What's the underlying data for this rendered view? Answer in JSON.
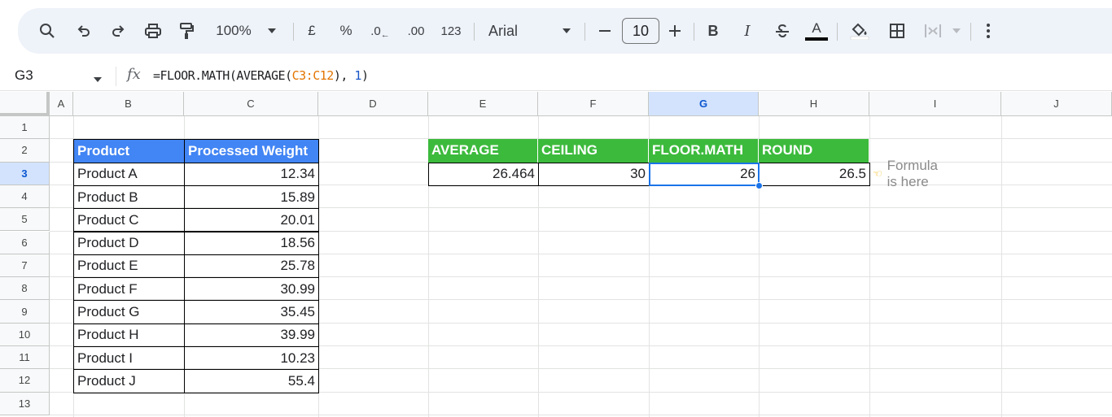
{
  "toolbar": {
    "zoom": "100%",
    "currency": "£",
    "percent": "%",
    "dec_decrease": ".0",
    "dec_increase": ".00",
    "number_format": "123",
    "font_name": "Arial",
    "font_size": "10",
    "bold": "B",
    "italic": "I",
    "text_color": "A"
  },
  "formula_bar": {
    "name_box": "G3",
    "fx": "fx",
    "formula_prefix": "=FLOOR.MATH(AVERAGE(",
    "formula_ref": "C3:C12",
    "formula_mid": "), ",
    "formula_num": "1",
    "formula_suffix": ")"
  },
  "columns": [
    "A",
    "B",
    "C",
    "D",
    "E",
    "F",
    "G",
    "H",
    "I",
    "J"
  ],
  "rows": [
    "1",
    "2",
    "3",
    "4",
    "5",
    "6",
    "7",
    "8",
    "9",
    "10",
    "11",
    "12",
    "13"
  ],
  "selected_cell": {
    "col": "G",
    "row": "3"
  },
  "product_table": {
    "headers": [
      "Product",
      "Processed Weight"
    ],
    "rows": [
      [
        "Product A",
        "12.34"
      ],
      [
        "Product B",
        "15.89"
      ],
      [
        "Product C",
        "20.01"
      ],
      [
        "Product D",
        "18.56"
      ],
      [
        "Product E",
        "25.78"
      ],
      [
        "Product F",
        "30.99"
      ],
      [
        "Product G",
        "35.45"
      ],
      [
        "Product H",
        "39.99"
      ],
      [
        "Product I",
        "10.23"
      ],
      [
        "Product J",
        "55.4"
      ]
    ]
  },
  "results_table": {
    "headers": [
      "AVERAGE",
      "CEILING",
      "FLOOR.MATH",
      "ROUND"
    ],
    "values": [
      "26.464",
      "30",
      "26",
      "26.5"
    ]
  },
  "note": {
    "icon": "pointing-hand-icon",
    "text": "Formula is here"
  },
  "colors": {
    "header_blue": "#4285f4",
    "header_green": "#3cba3c",
    "selection": "#1a73e8"
  }
}
